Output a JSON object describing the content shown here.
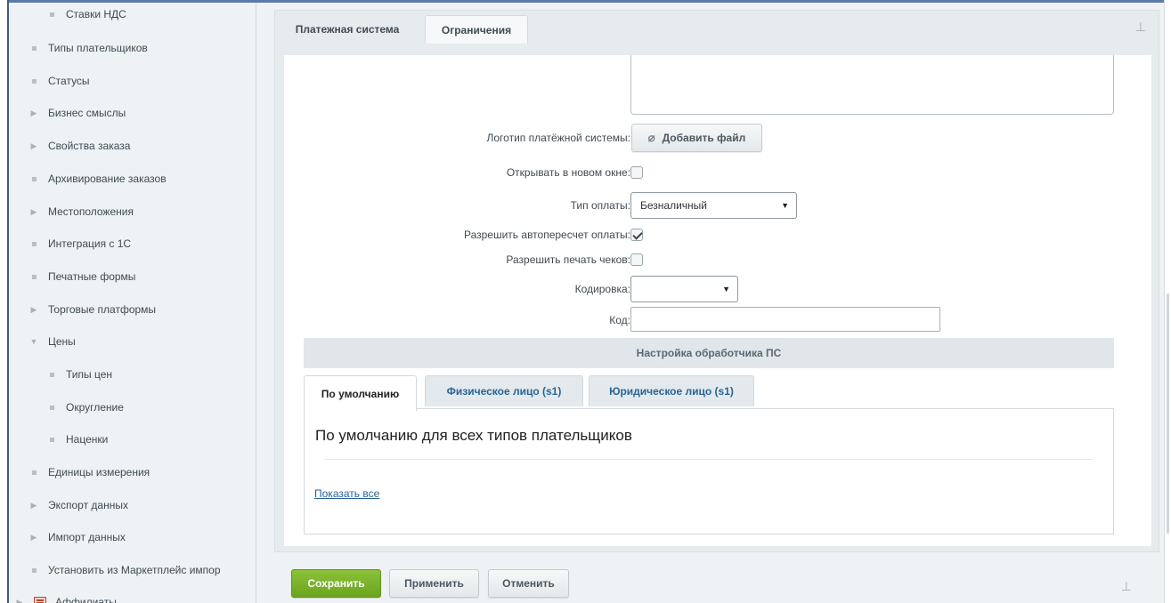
{
  "sidebar": {
    "items": [
      {
        "label": "Ставки НДС",
        "marker": "bullet"
      },
      {
        "label": "Типы плательщиков",
        "marker": "bullet"
      },
      {
        "label": "Статусы",
        "marker": "bullet"
      },
      {
        "label": "Бизнес смыслы",
        "marker": "arrow-right"
      },
      {
        "label": "Свойства заказа",
        "marker": "arrow-right"
      },
      {
        "label": "Архивирование заказов",
        "marker": "bullet"
      },
      {
        "label": "Местоположения",
        "marker": "arrow-right"
      },
      {
        "label": "Интеграция с 1С",
        "marker": "bullet"
      },
      {
        "label": "Печатные формы",
        "marker": "bullet"
      },
      {
        "label": "Торговые платформы",
        "marker": "arrow-right"
      },
      {
        "label": "Цены",
        "marker": "arrow-down"
      },
      {
        "label": "Типы цен",
        "marker": "bullet"
      },
      {
        "label": "Округление",
        "marker": "bullet"
      },
      {
        "label": "Наценки",
        "marker": "bullet"
      },
      {
        "label": "Единицы измерения",
        "marker": "bullet"
      },
      {
        "label": "Экспорт данных",
        "marker": "arrow-right"
      },
      {
        "label": "Импорт данных",
        "marker": "arrow-right"
      },
      {
        "label": "Установить из Маркетплейс импор",
        "marker": "bullet"
      },
      {
        "label": "Аффилиаты",
        "marker": "icon"
      }
    ]
  },
  "tabs": {
    "payment_system": "Платежная система",
    "restrictions": "Ограничения"
  },
  "form": {
    "logo_label": "Логотип платёжной системы:",
    "add_file_button": "Добавить файл",
    "open_new_window_label": "Открывать в новом окне:",
    "open_new_window_checked": false,
    "payment_type_label": "Тип оплаты:",
    "payment_type_value": "Безналичный",
    "allow_recalc_label": "Разрешить автопересчет оплаты:",
    "allow_recalc_checked": true,
    "allow_print_label": "Разрешить печать чеков:",
    "allow_print_checked": false,
    "encoding_label": "Кодировка:",
    "encoding_value": "",
    "code_label": "Код:",
    "code_value": ""
  },
  "handler_section": {
    "title": "Настройка обработчика ПС",
    "tabs": [
      "По умолчанию",
      "Физическое лицо (s1)",
      "Юридическое лицо (s1)"
    ],
    "active_tab_title": "По умолчанию для всех типов плательщиков",
    "show_all_link": "Показать все"
  },
  "footer": {
    "save": "Сохранить",
    "apply": "Применить",
    "cancel": "Отменить"
  },
  "colors": {
    "accent_green": "#76b02a",
    "link_blue": "#2a6496"
  }
}
